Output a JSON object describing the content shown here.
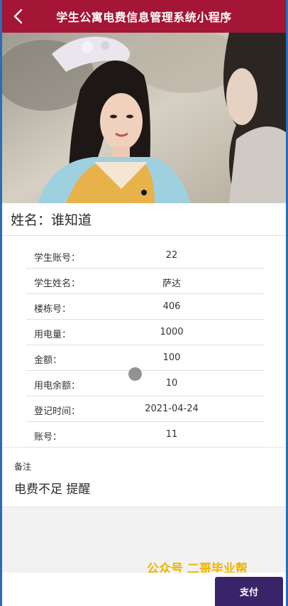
{
  "nav": {
    "title": "学生公寓电费信息管理系统小程序",
    "back_icon": "chevron-left-icon"
  },
  "header_color": "#a51535",
  "name_line": "姓名：谁知道",
  "details": [
    {
      "label": "学生账号：",
      "value": "22"
    },
    {
      "label": "学生姓名：",
      "value": "萨达"
    },
    {
      "label": "楼栋号：",
      "value": "406"
    },
    {
      "label": "用电量：",
      "value": "1000"
    },
    {
      "label": "金额：",
      "value": "100"
    },
    {
      "label": "用电余额：",
      "value": "10"
    },
    {
      "label": "登记时间：",
      "value": "2021-04-24"
    },
    {
      "label": "账号：",
      "value": "11"
    }
  ],
  "remark": {
    "label": "备注",
    "text": "电费不足 提醒"
  },
  "watermark": "公众号 二哥毕业帮",
  "pay_button": "支付",
  "pay_button_color": "#3a2469"
}
